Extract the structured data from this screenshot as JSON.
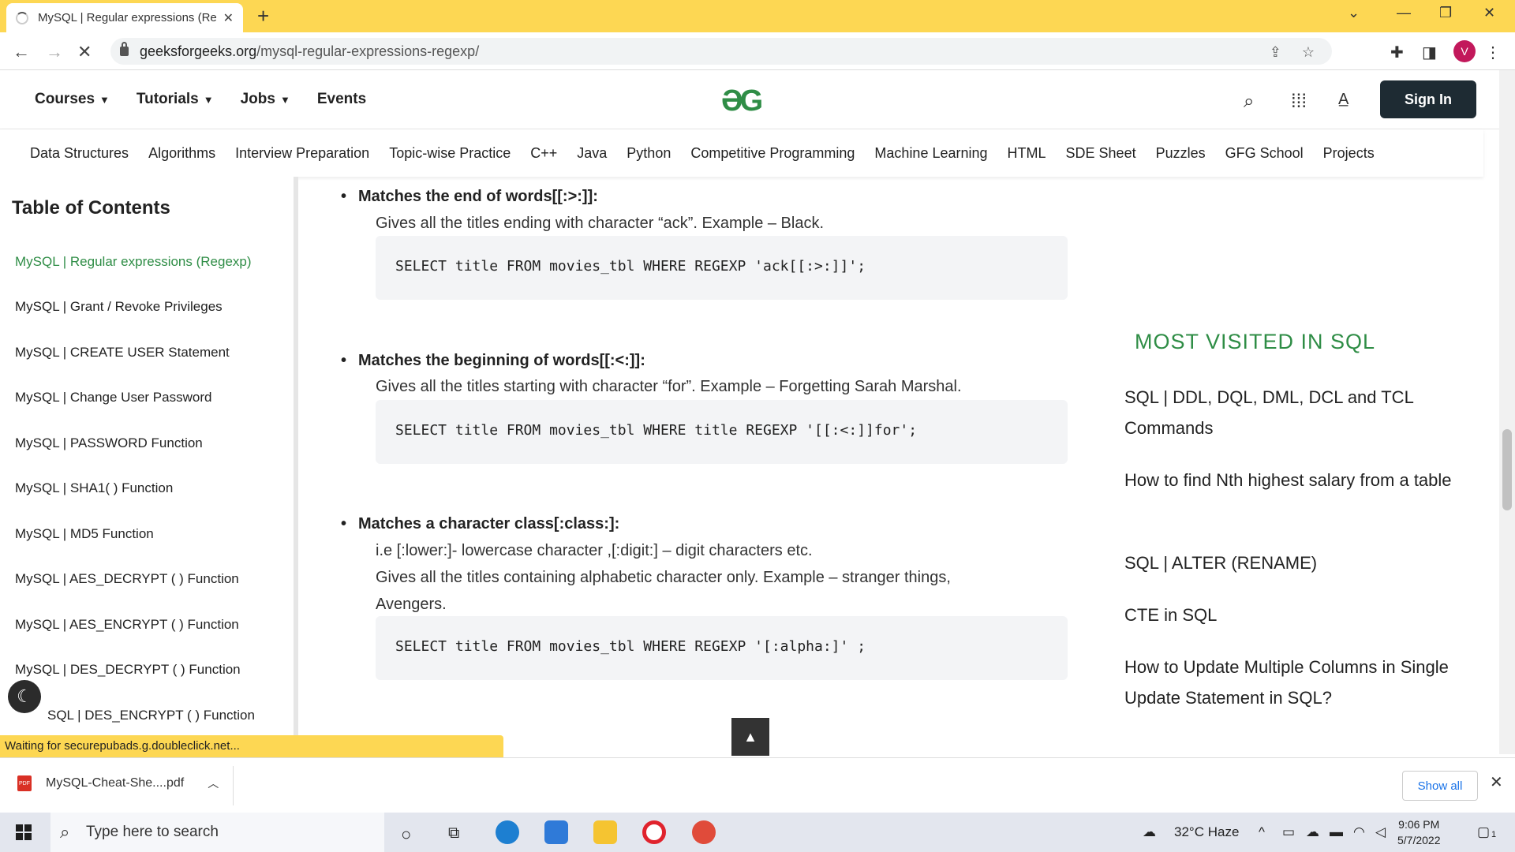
{
  "browser": {
    "tab_title": "MySQL | Regular expressions (Re",
    "url_domain": "geeksforgeeks.org",
    "url_path": "/mysql-regular-expressions-regexp/",
    "profile_initial": "V"
  },
  "header": {
    "menu": [
      "Courses",
      "Tutorials",
      "Jobs",
      "Events"
    ],
    "signin_label": "Sign In"
  },
  "topics": [
    "Data Structures",
    "Algorithms",
    "Interview Preparation",
    "Topic-wise Practice",
    "C++",
    "Java",
    "Python",
    "Competitive Programming",
    "Machine Learning",
    "HTML",
    "SDE Sheet",
    "Puzzles",
    "GFG School",
    "Projects"
  ],
  "toc": {
    "title": "Table of Contents",
    "items": [
      "MySQL | Regular expressions (Regexp)",
      "MySQL | Grant / Revoke Privileges",
      "MySQL | CREATE USER Statement",
      "MySQL | Change User Password",
      "MySQL | PASSWORD Function",
      "MySQL | SHA1( ) Function",
      "MySQL | MD5 Function",
      "MySQL | AES_DECRYPT ( ) Function",
      "MySQL | AES_ENCRYPT ( ) Function",
      "MySQL | DES_DECRYPT ( ) Function",
      "SQL | DES_ENCRYPT ( ) Function"
    ]
  },
  "article": {
    "s1_heading": "Matches the end of words[[:>:]]:",
    "s1_desc": "Gives all the titles ending with character “ack”. Example – Black.",
    "s1_code": "SELECT title FROM movies_tbl WHERE REGEXP 'ack[[:>:]]';",
    "s2_heading": "Matches the beginning of words[[:<:]]:",
    "s2_desc": "Gives all the titles starting with character “for”. Example – Forgetting Sarah Marshal.",
    "s2_code": "SELECT title FROM movies_tbl WHERE title REGEXP '[[:<:]]for';",
    "s3_heading": "Matches a character class[:class:]:",
    "s3_desc1": "i.e [:lower:]- lowercase character ,[:digit:] – digit characters etc.",
    "s3_desc2": "Gives all the titles containing alphabetic character only. Example – stranger things,",
    "s3_desc3": "Avengers.",
    "s3_code": "SELECT title FROM movies_tbl WHERE REGEXP '[:alpha:]' ;"
  },
  "sidebar": {
    "title": "MOST VISITED IN SQL",
    "links": [
      "SQL | DDL, DQL, DML, DCL and TCL Commands",
      "How to find Nth highest salary from a table",
      "SQL | ALTER (RENAME)",
      "CTE in SQL",
      "How to Update Multiple Columns in Single Update Statement in SQL?"
    ]
  },
  "status_text": "Waiting for securepubads.g.doubleclick.net...",
  "downloads": {
    "file_name": "MySQL-Cheat-She....pdf",
    "pdf_badge": "PDF",
    "show_all": "Show all"
  },
  "taskbar": {
    "search_placeholder": "Type here to search",
    "weather": "32°C  Haze",
    "time": "9:06 PM",
    "date": "5/7/2022",
    "notification_count": "1"
  },
  "colors": {
    "gfg_green": "#2f8d46",
    "tab_bar": "#fdd753",
    "signin_bg": "#1e2b33"
  }
}
